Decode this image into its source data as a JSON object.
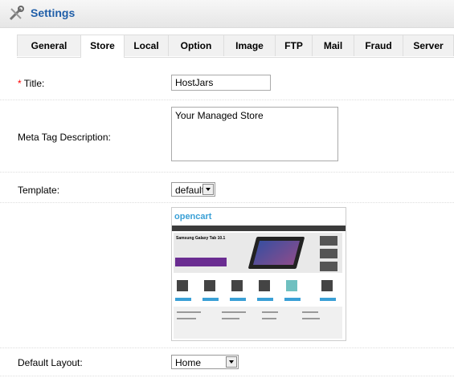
{
  "header": {
    "title": "Settings",
    "icon": "settings-tools-icon"
  },
  "tabs": [
    {
      "label": "General",
      "active": false
    },
    {
      "label": "Store",
      "active": true
    },
    {
      "label": "Local",
      "active": false
    },
    {
      "label": "Option",
      "active": false
    },
    {
      "label": "Image",
      "active": false
    },
    {
      "label": "FTP",
      "active": false
    },
    {
      "label": "Mail",
      "active": false
    },
    {
      "label": "Fraud",
      "active": false
    },
    {
      "label": "Server",
      "active": false
    }
  ],
  "form": {
    "title_required": "*",
    "title_label": " Title:",
    "title_value": "HostJars",
    "meta_label": "Meta Tag Description:",
    "meta_value": "Your Managed Store",
    "template_label": "Template:",
    "template_value": "default",
    "layout_label": "Default Layout:",
    "layout_value": "Home"
  },
  "preview": {
    "logo": "opencart",
    "banner_text": "Samsung Galaxy Tab 10.1"
  },
  "colors": {
    "header_title": "#1f5ea8",
    "required": "#ff0000"
  }
}
